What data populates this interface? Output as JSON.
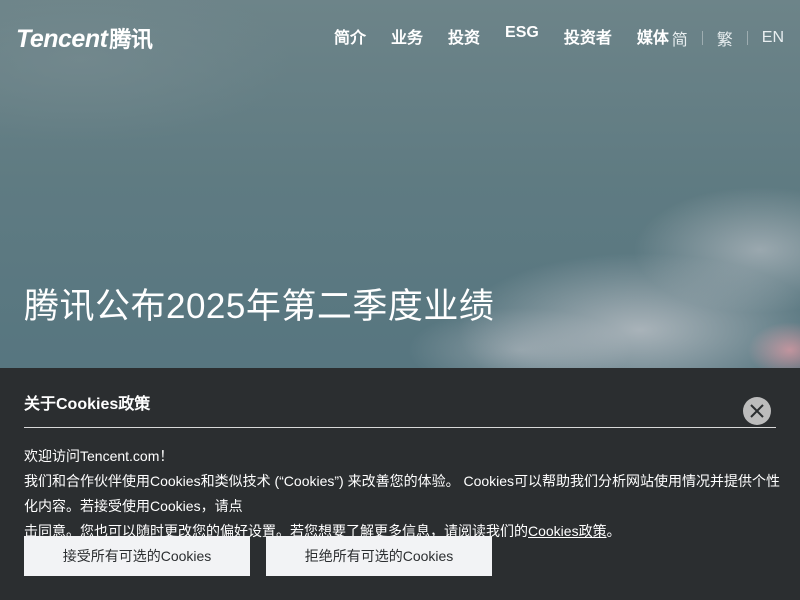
{
  "header": {
    "logo_text": "Tencent",
    "logo_cn": "腾讯",
    "nav": [
      {
        "label": "简介"
      },
      {
        "label": "业务"
      },
      {
        "label": "投资"
      },
      {
        "label": "ESG"
      },
      {
        "label": "投资者"
      },
      {
        "label": "媒体"
      }
    ],
    "lang": [
      "简",
      "繁",
      "EN"
    ]
  },
  "hero": {
    "title": "腾讯公布2025年第二季度业绩"
  },
  "cookie": {
    "title": "关于Cookies政策",
    "line1": "欢迎访问Tencent.com！",
    "line2": "我们和合作伙伴使用Cookies和类似技术 (“Cookies”) 来改善您的体验。 Cookies可以帮助我们分析网站使用情况并提供个性化内容。若接受使用Cookies，请点",
    "line3_prefix": "击同意。您也可以随时更改您的偏好设置。若您想要了解更多信息，请阅读我们的",
    "line3_link": "Cookies政策",
    "line3_suffix": "。",
    "accept_label": "接受所有可选的Cookies",
    "reject_label": "拒绝所有可选的Cookies"
  },
  "colors": {
    "banner_bg": "#2b2e30",
    "button_bg": "#f2f3f5",
    "close_bg": "#bcbcbc"
  }
}
